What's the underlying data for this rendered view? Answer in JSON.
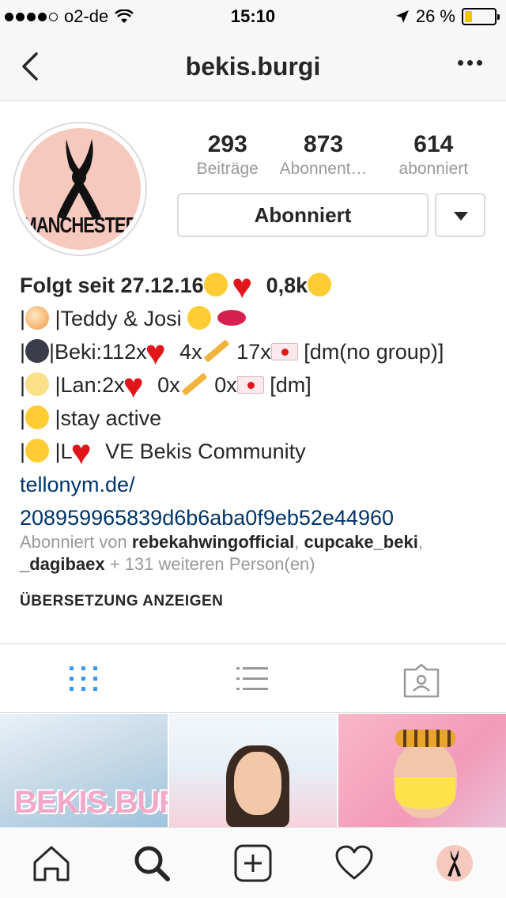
{
  "status_bar": {
    "carrier": "o2-de",
    "time": "15:10",
    "battery_percent": "26 %",
    "battery_level": 0.26
  },
  "nav": {
    "username": "bekis.burgi",
    "back_icon": "chevron-left-icon",
    "more_icon": "more-horizontal-icon"
  },
  "profile": {
    "avatar_text": "MANCHESTER",
    "stats": [
      {
        "num": "293",
        "label": "Beiträge"
      },
      {
        "num": "873",
        "label": "Abonnent…"
      },
      {
        "num": "614",
        "label": "abonniert"
      }
    ],
    "follow_button": "Abonniert"
  },
  "bio": {
    "line1_text": "Folgt seit 27.12.16",
    "line1_suffix": "0,8k",
    "line2": "|Teddy & Josi",
    "line3_a": "|Beki:112x",
    "line3_b": "4x",
    "line3_c": "17x",
    "line3_d": "[dm(no group)]",
    "line4_a": "|Lan:2x",
    "line4_b": "0x",
    "line4_c": "0x",
    "line4_d": "[dm]",
    "line5": "|stay active",
    "line6_a": "|L",
    "line6_b": "VE Bekis Community",
    "link_line1": "tellonym.de/",
    "link_line2": "208959965839d6b6aba0f9eb52e44960"
  },
  "followed_by": {
    "prefix": "Abonniert von",
    "user1": "rebekahwingofficial",
    "user2": "cupcake_beki",
    "user3": "_dagibaex",
    "suffix": "+ 131 weiteren Person(en)"
  },
  "translate_label": "ÜBERSETZUNG ANZEIGEN",
  "tabs": [
    {
      "name": "grid-view",
      "icon": "grid-icon",
      "active": true,
      "color": "#3897f0"
    },
    {
      "name": "list-view",
      "icon": "list-icon",
      "active": false
    },
    {
      "name": "tagged",
      "icon": "tagged-person-icon",
      "active": false
    }
  ],
  "grid_posts": [
    {
      "caption": "BEKIS.BURGI"
    },
    {
      "caption": ""
    },
    {
      "caption": ""
    }
  ],
  "bottom_bar": [
    {
      "icon": "home-icon"
    },
    {
      "icon": "search-icon",
      "active": true
    },
    {
      "icon": "add-post-icon"
    },
    {
      "icon": "heart-icon"
    },
    {
      "icon": "profile-avatar-icon"
    }
  ]
}
